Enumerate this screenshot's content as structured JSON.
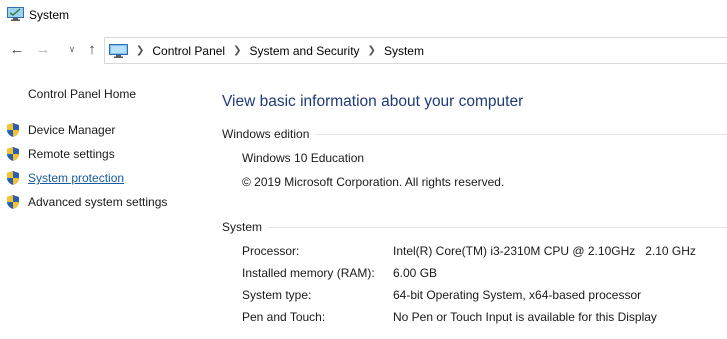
{
  "window": {
    "title": "System",
    "icon": "system-monitor-icon"
  },
  "nav": {
    "back_icon": "arrow-left-icon",
    "forward_icon": "arrow-right-icon",
    "recent_icon": "chevron-down-icon",
    "up_icon": "arrow-up-icon"
  },
  "address": {
    "breadcrumbs": [
      {
        "label": "Control Panel"
      },
      {
        "label": "System and Security"
      },
      {
        "label": "System"
      }
    ]
  },
  "sidebar": {
    "home_label": "Control Panel Home",
    "tasks": [
      {
        "label": "Device Manager",
        "icon": "uac-shield-icon"
      },
      {
        "label": "Remote settings",
        "icon": "uac-shield-icon"
      },
      {
        "label": "System protection",
        "icon": "uac-shield-icon"
      },
      {
        "label": "Advanced system settings",
        "icon": "uac-shield-icon"
      }
    ]
  },
  "main": {
    "title": "View basic information about your computer",
    "edition": {
      "heading": "Windows edition",
      "name": "Windows 10 Education",
      "copyright": "© 2019 Microsoft Corporation. All rights reserved."
    },
    "system": {
      "heading": "System",
      "rows": [
        {
          "key": "Processor:",
          "value": "Intel(R) Core(TM) i3-2310M CPU @ 2.10GHz   2.10 GHz"
        },
        {
          "key": "Installed memory (RAM):",
          "value": "6.00 GB"
        },
        {
          "key": "System type:",
          "value": "64-bit Operating System, x64-based processor"
        },
        {
          "key": "Pen and Touch:",
          "value": "No Pen or Touch Input is available for this Display"
        }
      ]
    }
  },
  "colors": {
    "title_blue": "#1e3a78",
    "link_blue": "#1a5aa0",
    "divider": "#e3e3e3"
  }
}
